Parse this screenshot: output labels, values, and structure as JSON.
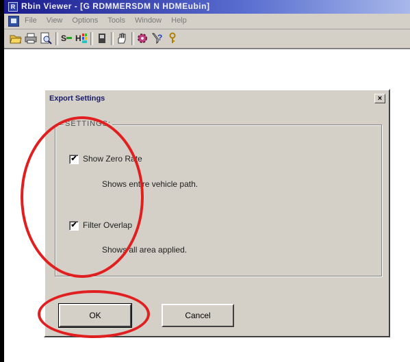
{
  "window": {
    "title": "Rbin Viewer - [G RDMMERSDM N HDMEubin]",
    "app_icon": "app-icon"
  },
  "menu": {
    "items": [
      "File",
      "View",
      "Options",
      "Tools",
      "Window",
      "Help"
    ]
  },
  "toolbar": {
    "icons": [
      "open-folder-icon",
      "print-icon",
      "print-preview-icon",
      "tool-s-icon",
      "tool-h-icon",
      "tool-book-icon",
      "hand-icon",
      "gear-icon",
      "help-icon",
      "key-icon"
    ]
  },
  "dialog": {
    "title": "Export Settings",
    "close": "×",
    "group_label": "SETTINGS:",
    "options": [
      {
        "label": "Show Zero Rate",
        "checked": true,
        "check": "✔",
        "description": "Shows entire vehicle path."
      },
      {
        "label": "Filter Overlap",
        "checked": true,
        "check": "✔",
        "description": "Shows all area applied."
      }
    ],
    "ok_label": "OK",
    "cancel_label": "Cancel"
  },
  "annotation_color": "#e02020"
}
